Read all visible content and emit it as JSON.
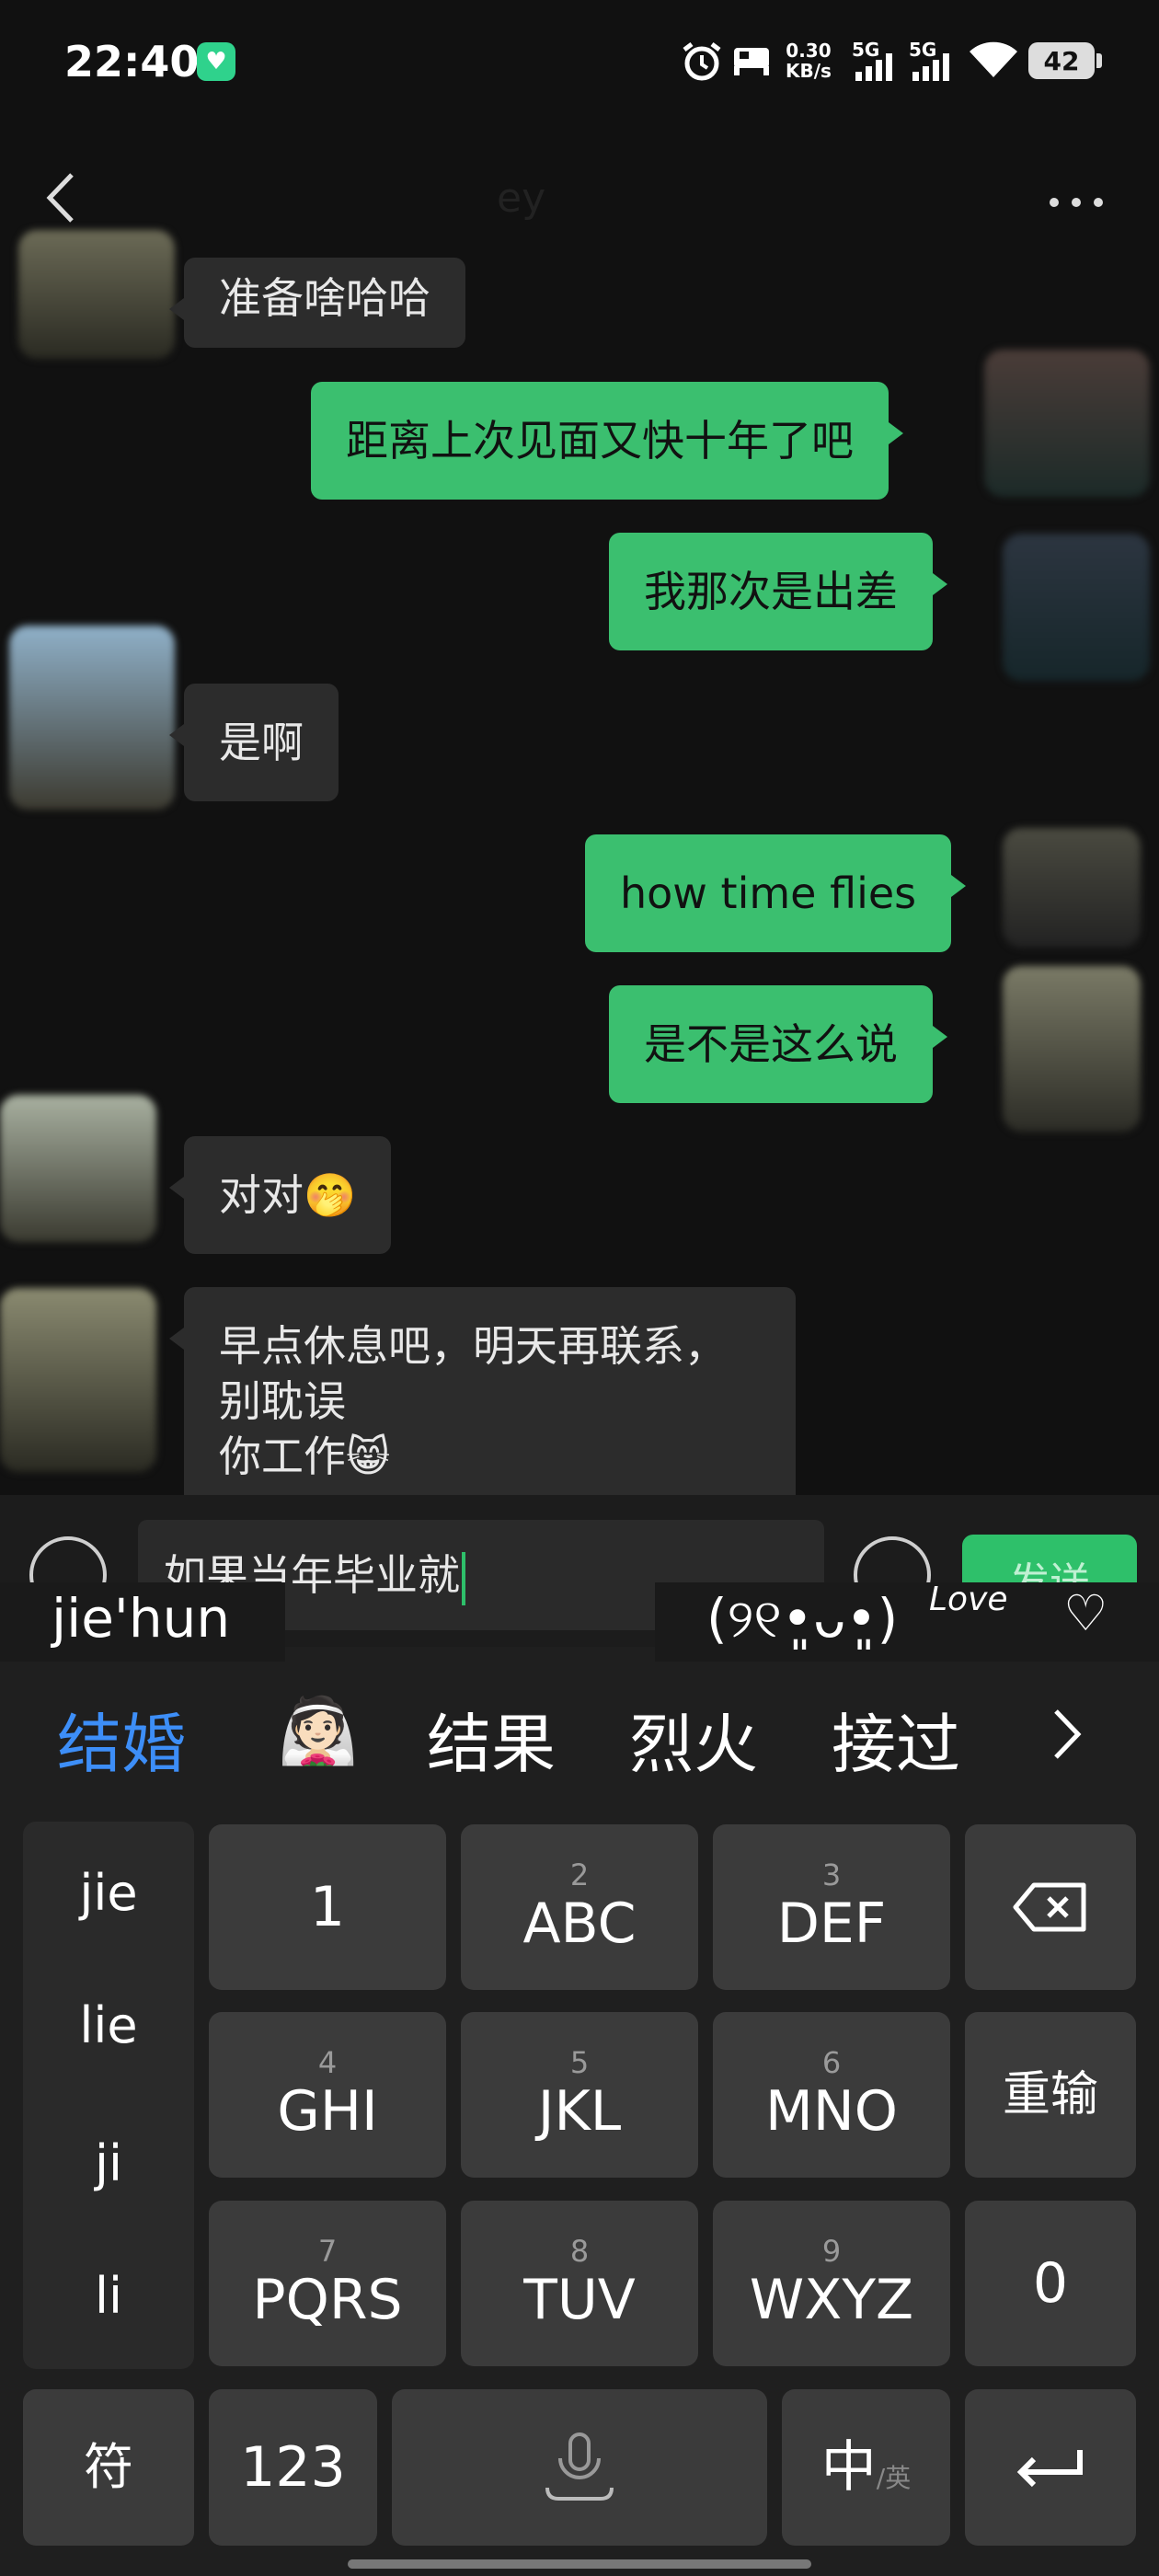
{
  "status_bar": {
    "time": "22:40",
    "net_speed_top": "0.30",
    "net_speed_bottom": "KB/s",
    "sig1": "5G",
    "sig2": "5G",
    "battery": "42"
  },
  "nav": {
    "title": "ey"
  },
  "messages": [
    {
      "side": "in",
      "text": "准备啥哈哈"
    },
    {
      "side": "out",
      "text": "距离上次见面又快十年了吧"
    },
    {
      "side": "out",
      "text": "我那次是出差"
    },
    {
      "side": "in",
      "text": "是啊"
    },
    {
      "side": "out",
      "text": "how time flies"
    },
    {
      "side": "out",
      "text": "是不是这么说"
    },
    {
      "side": "in",
      "text": "对对🤭"
    },
    {
      "side": "in",
      "text": "早点休息吧，明天再联系，别耽误\n你工作😸"
    }
  ],
  "input": {
    "text": "如果当年毕业就",
    "send_label": "发送"
  },
  "ime": {
    "pinyin": "jie'hun",
    "kaomoji": "(୨୧•͈ᴗ•͈)",
    "love": "Love",
    "candidates": [
      "结婚",
      "👰🏻",
      "结果",
      "烈火",
      "接过"
    ],
    "pinyin_options": [
      "jie",
      "lie",
      "ji",
      "li"
    ],
    "keys": {
      "k1": {
        "num": "",
        "label": "1"
      },
      "k2": {
        "num": "2",
        "label": "ABC"
      },
      "k3": {
        "num": "3",
        "label": "DEF"
      },
      "k4": {
        "num": "4",
        "label": "GHI"
      },
      "k5": {
        "num": "5",
        "label": "JKL"
      },
      "k6": {
        "num": "6",
        "label": "MNO"
      },
      "k7": {
        "num": "7",
        "label": "PQRS"
      },
      "k8": {
        "num": "8",
        "label": "TUV"
      },
      "k9": {
        "num": "9",
        "label": "WXYZ"
      },
      "reinput": "重输",
      "zero": "0",
      "symbol": "符",
      "num_mode": "123",
      "lang_main": "中",
      "lang_alt": "/英"
    }
  }
}
